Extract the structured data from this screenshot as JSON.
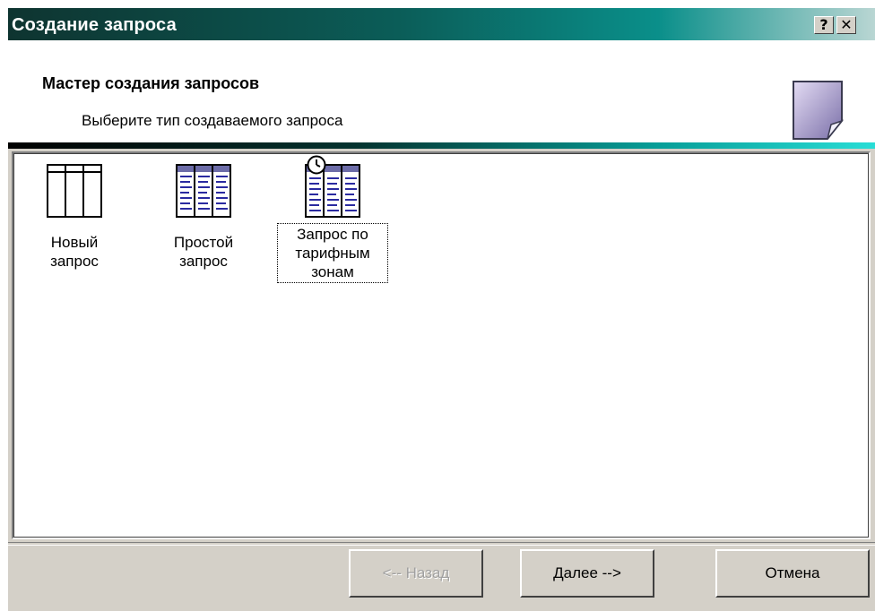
{
  "window": {
    "title": "Создание запроса",
    "help_label": "?",
    "close_label": "✕"
  },
  "header": {
    "title": "Мастер создания запросов",
    "subtitle": "Выберите тип создаваемого запроса"
  },
  "items": [
    {
      "label": "Новый\nзапрос",
      "icon": "blank-grid-icon"
    },
    {
      "label": "Простой\nзапрос",
      "icon": "simple-query-icon"
    },
    {
      "label": "Запрос по\nтарифным\nзонам",
      "icon": "tariff-zone-query-icon",
      "focused": true
    }
  ],
  "buttons": {
    "back": "<-- Назад",
    "next": "Далее -->",
    "cancel": "Отмена"
  },
  "colors": {
    "title_bar_start": "#0e3430",
    "title_bar_end": "#b9d6d3",
    "face": "#d4d0c8"
  }
}
